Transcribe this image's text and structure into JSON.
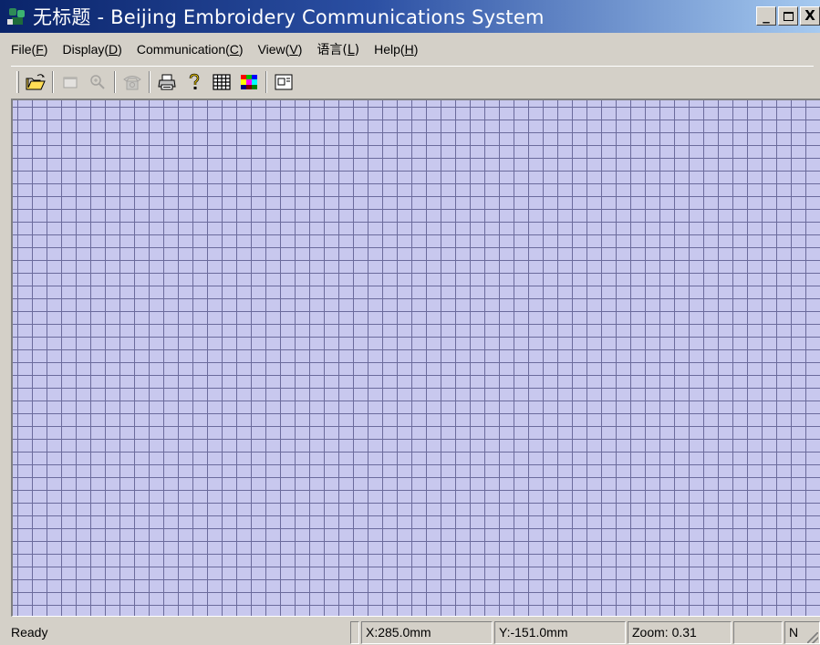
{
  "window": {
    "title": "无标题 - Beijing Embroidery Communications System",
    "app_icon": "embroidery-app-icon",
    "controls": {
      "minimize": "_",
      "maximize": "□",
      "close": "X"
    }
  },
  "menu": [
    {
      "label": "File(F)",
      "mnemonic": "F"
    },
    {
      "label": "Display(D)",
      "mnemonic": "D"
    },
    {
      "label": "Communication(C)",
      "mnemonic": "C"
    },
    {
      "label": "View(V)",
      "mnemonic": "V"
    },
    {
      "label": "语言(L)",
      "mnemonic": "L"
    },
    {
      "label": "Help(H)",
      "mnemonic": "H"
    }
  ],
  "toolbar": [
    {
      "icon": "open-folder-icon",
      "enabled": true
    },
    {
      "icon": "window-icon",
      "enabled": false
    },
    {
      "icon": "zoom-icon",
      "enabled": false
    },
    {
      "icon": "telephone-icon",
      "enabled": false
    },
    {
      "icon": "printer-icon",
      "enabled": true
    },
    {
      "icon": "help-icon",
      "enabled": true
    },
    {
      "icon": "grid-icon",
      "enabled": true
    },
    {
      "icon": "color-palette-icon",
      "enabled": true
    },
    {
      "icon": "about-window-icon",
      "enabled": true
    }
  ],
  "canvas": {
    "background_color": "#c8c8ee",
    "grid_color": "#6b6b9c"
  },
  "status": {
    "ready": "Ready",
    "x": "X:285.0mm",
    "y": "Y:-151.0mm",
    "zoom": "Zoom: 0.31",
    "mode": "N"
  },
  "colors": {
    "titlebar_start": "#0a246a",
    "titlebar_end": "#a6caf0",
    "chrome": "#d4d0c8"
  }
}
